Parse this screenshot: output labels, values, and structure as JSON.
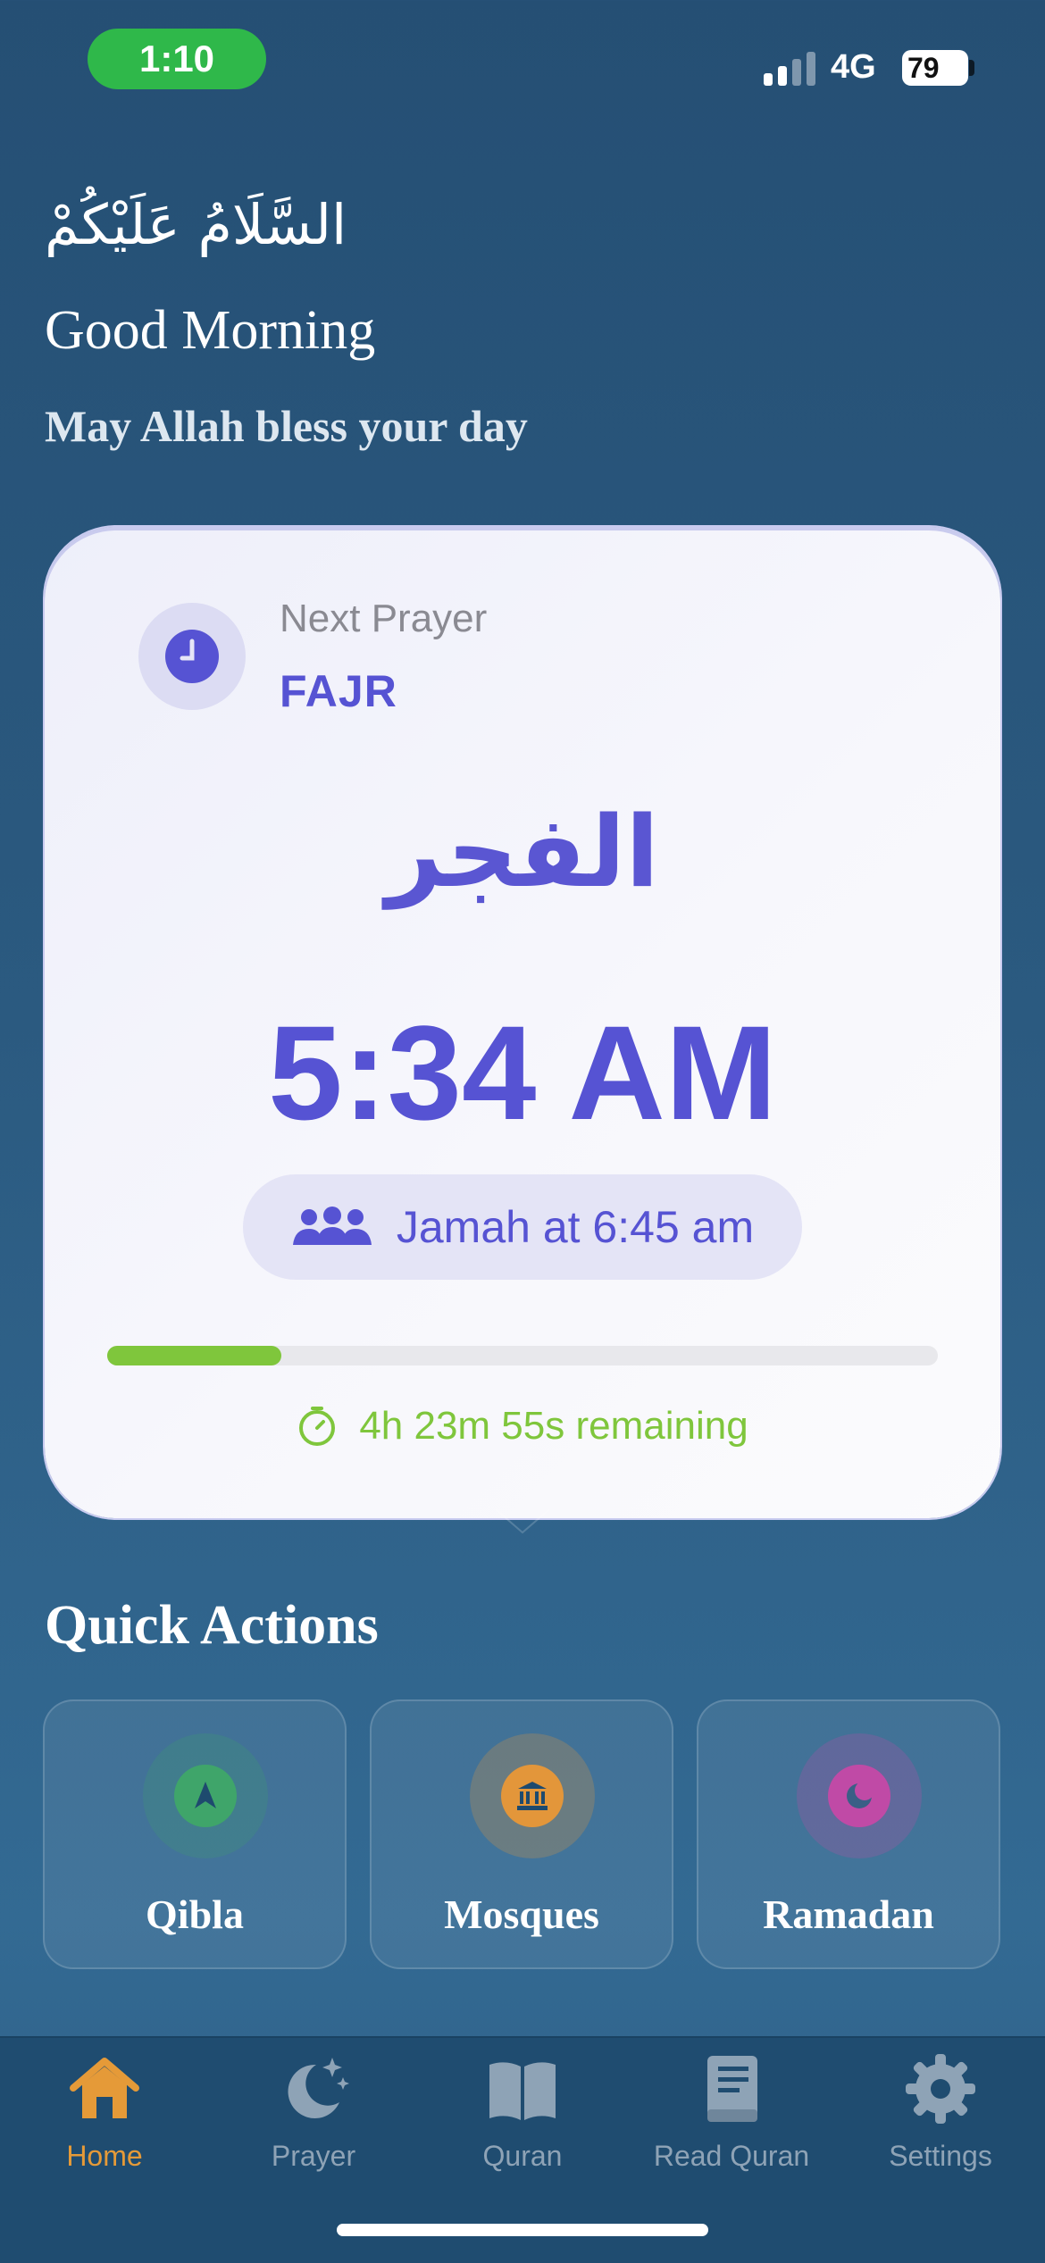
{
  "status_bar": {
    "time": "1:10",
    "network": "4G",
    "battery": "79"
  },
  "greeting": {
    "salam": "السَّلَامُ عَلَيْكُمْ",
    "good_morning": "Good Morning",
    "blessing": "May Allah bless your day"
  },
  "next_prayer": {
    "label": "Next Prayer",
    "name": "FAJR",
    "arabic_name": "الفجر",
    "time": "5:34 AM",
    "jamah": "Jamah at 6:45 am",
    "progress_fraction": 0.21,
    "remaining": "4h 23m 55s remaining"
  },
  "quick_actions": {
    "title": "Quick Actions",
    "items": [
      {
        "label": "Qibla",
        "icon": "compass-arrow-icon",
        "color": "#3fa56a"
      },
      {
        "label": "Mosques",
        "icon": "mosque-icon",
        "color": "#e3963a"
      },
      {
        "label": "Ramadan",
        "icon": "crescent-icon",
        "color": "#c04aa6"
      }
    ]
  },
  "tabs": [
    {
      "label": "Home",
      "icon": "home-icon",
      "active": true
    },
    {
      "label": "Prayer",
      "icon": "moon-stars-icon",
      "active": false
    },
    {
      "label": "Quran",
      "icon": "book-open-icon",
      "active": false
    },
    {
      "label": "Read Quran",
      "icon": "book-icon",
      "active": false
    },
    {
      "label": "Settings",
      "icon": "gear-icon",
      "active": false
    }
  ],
  "colors": {
    "accent": "#5653d3",
    "progress": "#7fc63c",
    "active_tab": "#e59a38"
  }
}
